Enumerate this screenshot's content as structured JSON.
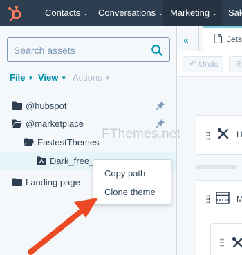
{
  "topnav": {
    "items": [
      {
        "label": "Contacts"
      },
      {
        "label": "Conversations"
      },
      {
        "label": "Marketing"
      },
      {
        "label": "Sale"
      }
    ]
  },
  "sidebar": {
    "search": {
      "placeholder": "Search assets"
    },
    "toolbar": {
      "file": "File",
      "view": "View",
      "actions": "Actions"
    },
    "tree": [
      {
        "label": "@hubspot"
      },
      {
        "label": "@marketplace"
      },
      {
        "label": "FastestThemes"
      },
      {
        "label": "Dark_free_"
      },
      {
        "label": "Landing page"
      }
    ]
  },
  "context_menu": {
    "items": [
      {
        "label": "Copy path"
      },
      {
        "label": "Clone theme"
      }
    ]
  },
  "editor": {
    "tab_label": "Jets",
    "undo_label": "Undo",
    "redo_label": "R",
    "card_labels": [
      "H",
      "M"
    ]
  },
  "watermark": "FThemes.net",
  "colors": {
    "nav_bg": "#2d3e50",
    "accent": "#0091ae",
    "logo": "#ff7a59",
    "arrow": "#ec4a24"
  }
}
